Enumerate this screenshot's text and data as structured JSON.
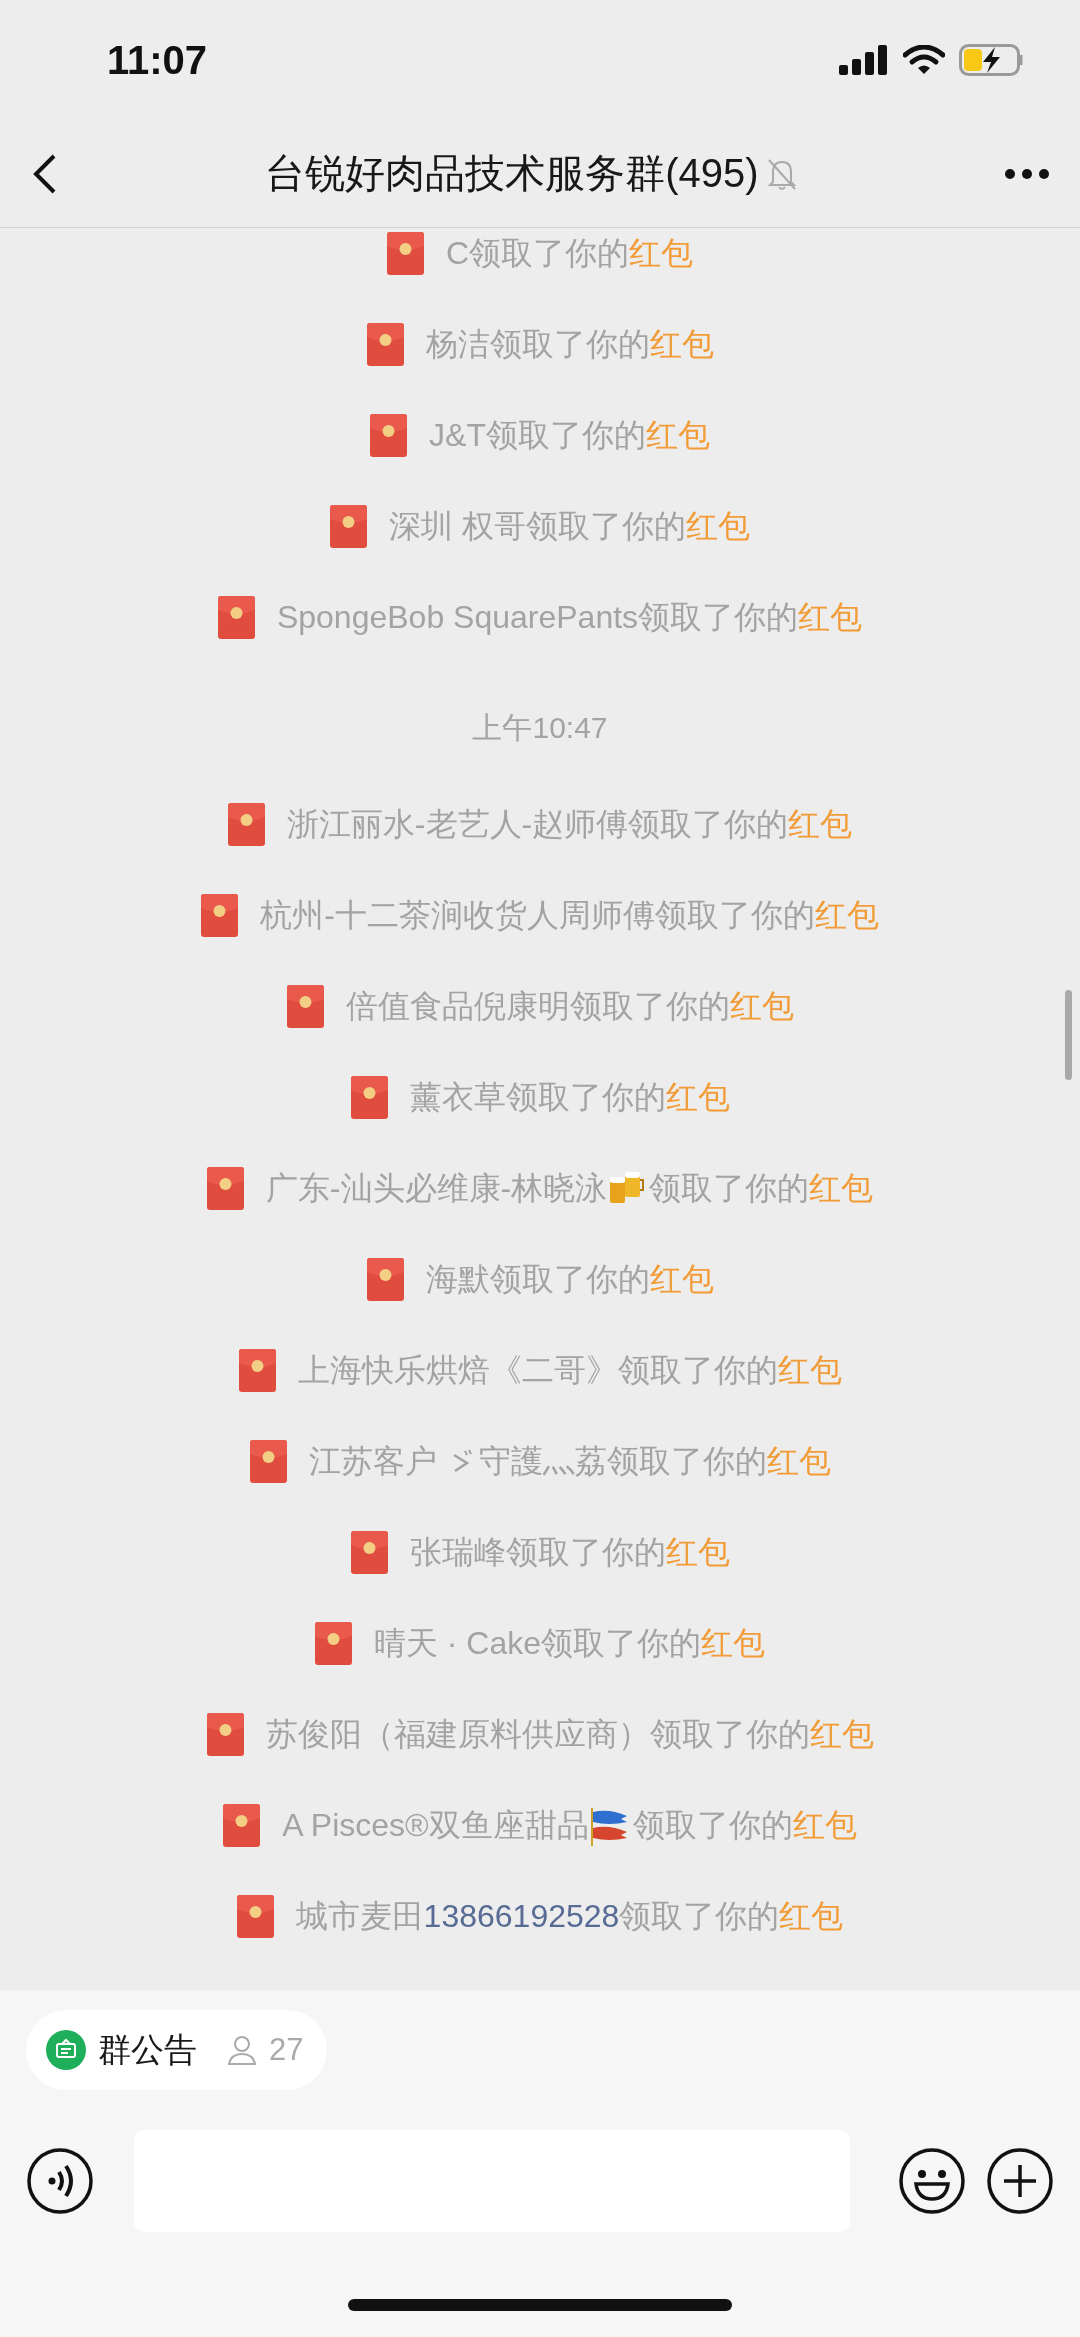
{
  "status_bar": {
    "time": "11:07"
  },
  "header": {
    "title": "台锐好肉品技术服务群(495)",
    "muted": true
  },
  "messages": [
    {
      "kind": "notice",
      "parts": [
        {
          "kind": "text",
          "text": "C"
        }
      ],
      "action": "领取了你的",
      "link": "红包"
    },
    {
      "kind": "notice",
      "parts": [
        {
          "kind": "text",
          "text": "杨洁"
        }
      ],
      "action": "领取了你的",
      "link": "红包"
    },
    {
      "kind": "notice",
      "parts": [
        {
          "kind": "text",
          "text": "J&T"
        }
      ],
      "action": "领取了你的",
      "link": "红包"
    },
    {
      "kind": "notice",
      "parts": [
        {
          "kind": "text",
          "text": "深圳 权哥"
        }
      ],
      "action": "领取了你的",
      "link": "红包"
    },
    {
      "kind": "notice",
      "parts": [
        {
          "kind": "text",
          "text": "SpongeBob SquarePants"
        }
      ],
      "action": "领取了你的",
      "link": "红包"
    },
    {
      "kind": "time",
      "text": "上午10:47"
    },
    {
      "kind": "notice",
      "parts": [
        {
          "kind": "text",
          "text": "浙江丽水-老艺人-赵师傅"
        }
      ],
      "action": "领取了你的",
      "link": "红包"
    },
    {
      "kind": "notice",
      "parts": [
        {
          "kind": "text",
          "text": "杭州-十二茶涧收货人周师傅"
        }
      ],
      "action": "领取了你的",
      "link": "红包"
    },
    {
      "kind": "notice",
      "parts": [
        {
          "kind": "text",
          "text": "倍值食品倪康明"
        }
      ],
      "action": "领取了你的",
      "link": "红包"
    },
    {
      "kind": "notice",
      "parts": [
        {
          "kind": "text",
          "text": "薰衣草"
        }
      ],
      "action": "领取了你的",
      "link": "红包"
    },
    {
      "kind": "notice",
      "parts": [
        {
          "kind": "text",
          "text": "广东-汕头必维康-林晓泳"
        },
        {
          "kind": "beer"
        }
      ],
      "action": "领取了你的",
      "link": "红包"
    },
    {
      "kind": "notice",
      "parts": [
        {
          "kind": "text",
          "text": "海默"
        }
      ],
      "action": "领取了你的",
      "link": "红包"
    },
    {
      "kind": "notice",
      "parts": [
        {
          "kind": "text",
          "text": "上海快乐烘焙《二哥》"
        }
      ],
      "action": "领取了你的",
      "link": "红包"
    },
    {
      "kind": "notice",
      "parts": [
        {
          "kind": "text",
          "text": "江苏客户"
        },
        {
          "kind": "squiggle"
        },
        {
          "kind": "text",
          "text": "守護灬荔"
        }
      ],
      "action": "领取了你的",
      "link": "红包"
    },
    {
      "kind": "notice",
      "parts": [
        {
          "kind": "text",
          "text": "张瑞峰"
        }
      ],
      "action": "领取了你的",
      "link": "红包"
    },
    {
      "kind": "notice",
      "parts": [
        {
          "kind": "text",
          "text": "晴天 · Cake"
        }
      ],
      "action": "领取了你的",
      "link": "红包"
    },
    {
      "kind": "notice",
      "parts": [
        {
          "kind": "text",
          "text": "苏俊阳（福建原料供应商）"
        }
      ],
      "action": "领取了你的",
      "link": "红包"
    },
    {
      "kind": "notice",
      "parts": [
        {
          "kind": "text",
          "text": "A   Pisces®双鱼座甜品"
        },
        {
          "kind": "carp"
        }
      ],
      "action": "领取了你的",
      "link": "红包"
    },
    {
      "kind": "notice",
      "parts": [
        {
          "kind": "text",
          "text": "城市麦田"
        },
        {
          "kind": "phone",
          "text": "13866192528"
        }
      ],
      "action": "领取了你的",
      "link": "红包"
    }
  ],
  "announcement": {
    "label": "群公告",
    "count": "27"
  }
}
